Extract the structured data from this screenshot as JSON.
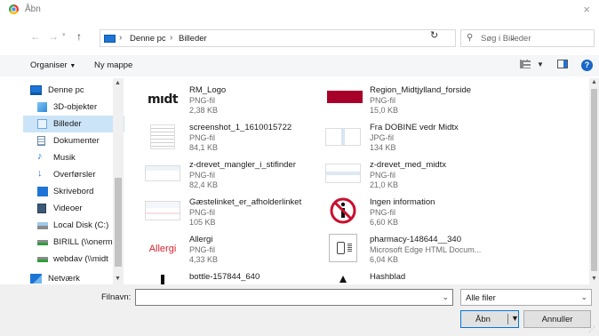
{
  "window": {
    "title": "Åbn",
    "close_glyph": "×"
  },
  "nav": {
    "back": "←",
    "forward": "→",
    "up": "↑",
    "breadcrumb": [
      "Denne pc",
      "Billeder"
    ],
    "search_placeholder": "Søg i Billeder"
  },
  "toolbar": {
    "organize": "Organiser",
    "new_folder": "Ny mappe",
    "help": "?"
  },
  "sidebar": {
    "items": [
      {
        "label": "Denne pc",
        "icon": "computer-icon"
      },
      {
        "label": "3D-objekter",
        "icon": "cube-icon"
      },
      {
        "label": "Billeder",
        "icon": "pictures-icon",
        "selected": true
      },
      {
        "label": "Dokumenter",
        "icon": "document-icon"
      },
      {
        "label": "Musik",
        "icon": "music-icon"
      },
      {
        "label": "Overførsler",
        "icon": "download-icon"
      },
      {
        "label": "Skrivebord",
        "icon": "desktop-icon"
      },
      {
        "label": "Videoer",
        "icon": "video-icon"
      },
      {
        "label": "Local Disk (C:)",
        "icon": "disk-icon"
      },
      {
        "label": "BIRILL (\\\\onerm.",
        "icon": "network-drive-icon"
      },
      {
        "label": "webdav (\\\\midt",
        "icon": "network-drive-icon"
      },
      {
        "label": "Netværk",
        "icon": "network-icon"
      }
    ]
  },
  "files": [
    {
      "name": "RM_Logo",
      "type": "PNG-fil",
      "size": "2,38 KB",
      "thumb": "mdt"
    },
    {
      "name": "Region_Midtjylland_forside",
      "type": "PNG-fil",
      "size": "15,0 KB",
      "thumb": "red-bar"
    },
    {
      "name": "screenshot_1_1610015722",
      "type": "PNG-fil",
      "size": "84,1 KB",
      "thumb": "doc"
    },
    {
      "name": "Fra DOBINE vedr Midtx",
      "type": "JPG-fil",
      "size": "134 KB",
      "thumb": "screen"
    },
    {
      "name": "z-drevet_mangler_i_stifinder",
      "type": "PNG-fil",
      "size": "82,4 KB",
      "thumb": "screen"
    },
    {
      "name": "z-drevet_med_midtx",
      "type": "PNG-fil",
      "size": "21,0 KB",
      "thumb": "screen"
    },
    {
      "name": "Gæstelinket_er_afholderlinket",
      "type": "PNG-fil",
      "size": "105 KB",
      "thumb": "screen"
    },
    {
      "name": "Ingen information",
      "type": "PNG-fil",
      "size": "6,60 KB",
      "thumb": "no-info"
    },
    {
      "name": "Allergi",
      "type": "PNG-fil",
      "size": "4,33 KB",
      "thumb": "allergi"
    },
    {
      "name": "pharmacy-148644__340",
      "type": "Microsoft Edge HTML Docum...",
      "size": "6,04 KB",
      "thumb": "edge-doc"
    },
    {
      "name": "bottle-157844_640",
      "type": "",
      "size": "",
      "thumb": "bottle"
    },
    {
      "name": "Hashblad",
      "type": "",
      "size": "",
      "thumb": "triangle"
    }
  ],
  "thumb_text": {
    "mdt": "mıdt",
    "allergi": "Allergi"
  },
  "footer": {
    "filename_label": "Filnavn:",
    "filename_value": "",
    "filter": "Alle filer",
    "open": "Åbn",
    "cancel": "Annuller"
  },
  "colors": {
    "accent": "#0078d7",
    "selected": "#cce4f7",
    "brand_red": "#a6002a"
  }
}
